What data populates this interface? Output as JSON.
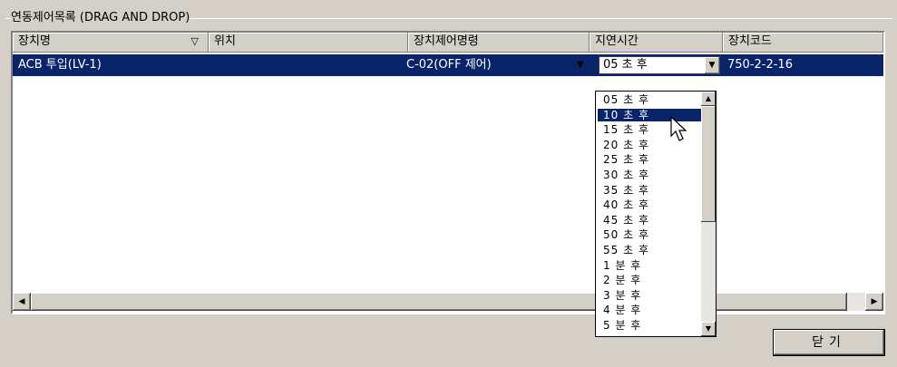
{
  "group": {
    "title": "연동제어목록 (DRAG AND DROP)"
  },
  "list": {
    "columns": [
      {
        "label": "장치명"
      },
      {
        "label": "위치"
      },
      {
        "label": "장치제어명령"
      },
      {
        "label": "지연시간"
      },
      {
        "label": "장치코드"
      }
    ],
    "sort_icon": "sort-down-triangle",
    "rows": [
      {
        "name": "ACB 투입(LV-1)",
        "location": "",
        "command": "C-02(OFF 제어)",
        "delay": "05 초 후",
        "code": "750-2-2-16"
      }
    ]
  },
  "dropdown": {
    "selected": "05 초 후",
    "highlighted_index": 1,
    "options": [
      "05 초 후",
      "10 초 후",
      "15 초 후",
      "20 초 후",
      "25 초 후",
      "30 초 후",
      "35 초 후",
      "40 초 후",
      "45 초 후",
      "50 초 후",
      "55 초 후",
      "1 분 후",
      "2 분 후",
      "3 분 후",
      "4 분 후",
      "5 분 후"
    ]
  },
  "buttons": {
    "close": "닫기"
  },
  "colors": {
    "selection": "#0a246a",
    "face": "#d4d0c8"
  }
}
